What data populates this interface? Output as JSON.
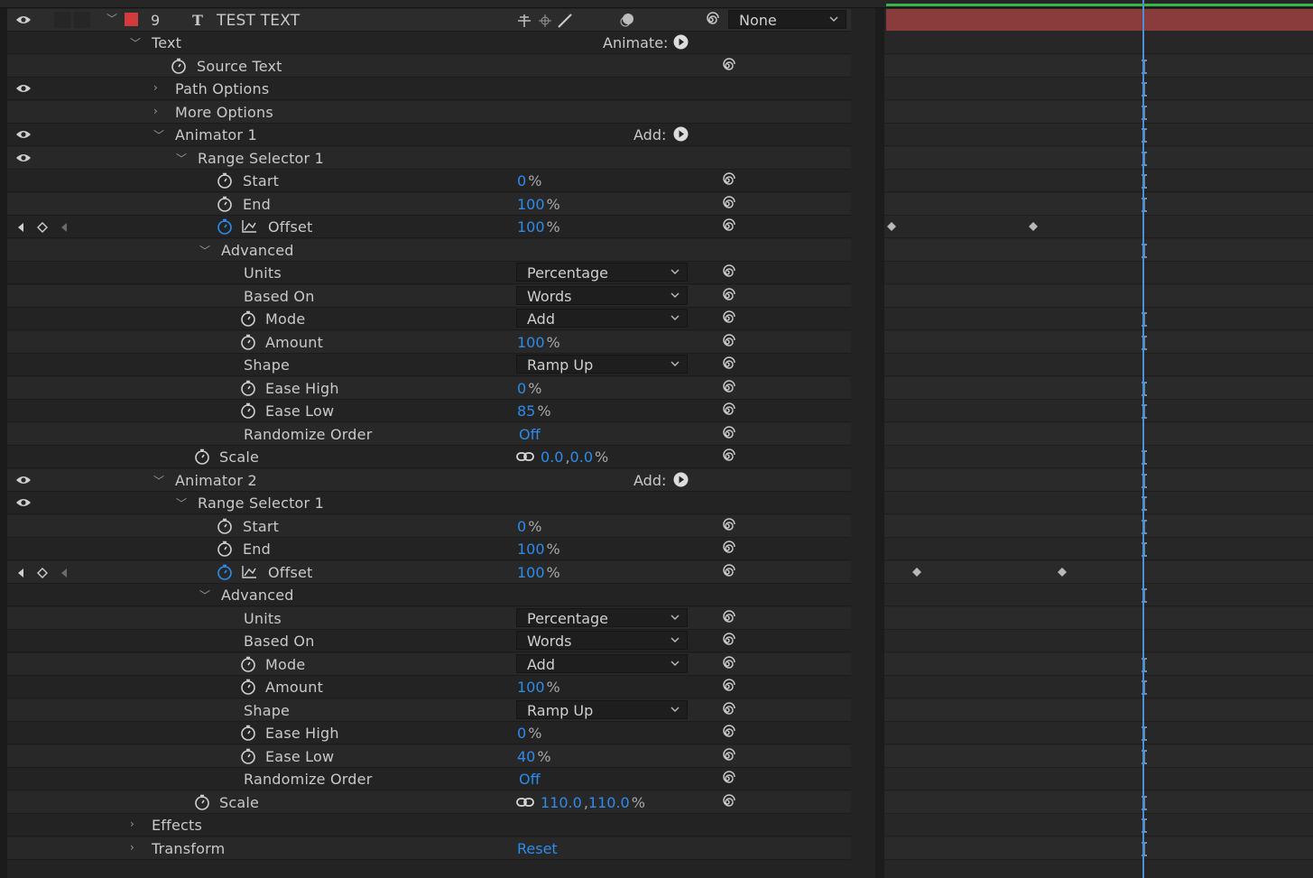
{
  "layer": {
    "number": "9",
    "type_glyph": "T",
    "name": "TEST TEXT",
    "parent": "None",
    "label_color": "#d23b3b"
  },
  "rows": {
    "text_group": "Text",
    "animate_label": "Animate:",
    "source_text": "Source Text",
    "path_options": "Path Options",
    "more_options": "More Options",
    "effects": "Effects",
    "transform": "Transform",
    "transform_reset": "Reset"
  },
  "animator1": {
    "name": "Animator 1",
    "add_label": "Add:",
    "range_selector": "Range Selector 1",
    "start": {
      "label": "Start",
      "value": "0",
      "unit": "%"
    },
    "end": {
      "label": "End",
      "value": "100",
      "unit": "%"
    },
    "offset": {
      "label": "Offset",
      "value": "100",
      "unit": "%"
    },
    "advanced": "Advanced",
    "units": {
      "label": "Units",
      "value": "Percentage"
    },
    "based_on": {
      "label": "Based On",
      "value": "Words"
    },
    "mode": {
      "label": "Mode",
      "value": "Add"
    },
    "amount": {
      "label": "Amount",
      "value": "100",
      "unit": "%"
    },
    "shape": {
      "label": "Shape",
      "value": "Ramp Up"
    },
    "ease_high": {
      "label": "Ease High",
      "value": "0",
      "unit": "%"
    },
    "ease_low": {
      "label": "Ease Low",
      "value": "85",
      "unit": "%"
    },
    "randomize": {
      "label": "Randomize Order",
      "value": "Off"
    },
    "scale": {
      "label": "Scale",
      "value_x": "0.0",
      "sep": ",",
      "value_y": "0.0",
      "unit": "%"
    }
  },
  "animator2": {
    "name": "Animator 2",
    "add_label": "Add:",
    "range_selector": "Range Selector 1",
    "start": {
      "label": "Start",
      "value": "0",
      "unit": "%"
    },
    "end": {
      "label": "End",
      "value": "100",
      "unit": "%"
    },
    "offset": {
      "label": "Offset",
      "value": "100",
      "unit": "%"
    },
    "advanced": "Advanced",
    "units": {
      "label": "Units",
      "value": "Percentage"
    },
    "based_on": {
      "label": "Based On",
      "value": "Words"
    },
    "mode": {
      "label": "Mode",
      "value": "Add"
    },
    "amount": {
      "label": "Amount",
      "value": "100",
      "unit": "%"
    },
    "shape": {
      "label": "Shape",
      "value": "Ramp Up"
    },
    "ease_high": {
      "label": "Ease High",
      "value": "0",
      "unit": "%"
    },
    "ease_low": {
      "label": "Ease Low",
      "value": "40",
      "unit": "%"
    },
    "randomize": {
      "label": "Randomize Order",
      "value": "Off"
    },
    "scale": {
      "label": "Scale",
      "value_x": "110.0",
      "sep": ",",
      "value_y": "110.0",
      "unit": "%"
    }
  },
  "colors": {
    "value_blue": "#2d8ceb",
    "playhead": "#4d8fd6",
    "layer_bar": "#8a3c3c",
    "work_area": "#3bb54a"
  },
  "icons": {
    "visibility": "eye-icon",
    "stopwatch": "stopwatch-icon",
    "pickwhip": "pickwhip-spiral-icon",
    "graph": "graph-icon",
    "link": "constrain-proportions-link-icon",
    "keyframe": "keyframe-diamond-icon"
  }
}
